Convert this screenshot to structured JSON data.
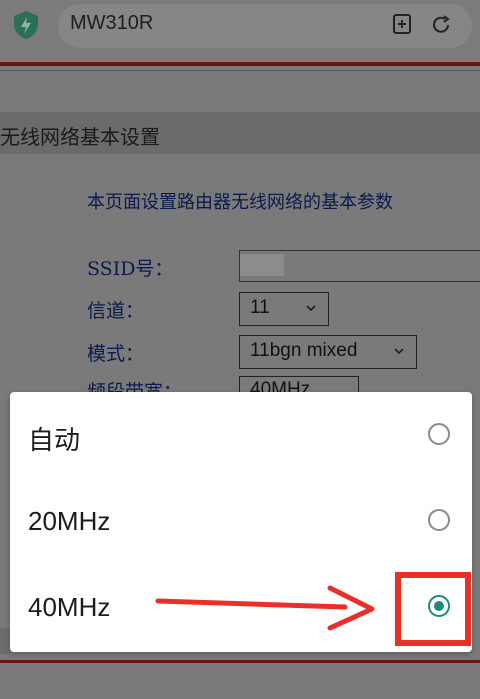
{
  "browser": {
    "url_title": "MW310R",
    "icons": [
      "shield-icon",
      "bookmark-add-icon",
      "reload-icon"
    ]
  },
  "page": {
    "section_title": "无线网络基本设置",
    "description": "本页面设置路由器无线网络的基本参数",
    "fields": {
      "ssid_label": "SSID号：",
      "channel_label": "信道：",
      "channel_value": "11",
      "mode_label": "模式：",
      "mode_value": "11bgn mixed",
      "bandwidth_label": "频段带宽：",
      "bandwidth_value": "40MHz"
    }
  },
  "dialog": {
    "options": [
      {
        "label": "自动",
        "checked": false
      },
      {
        "label": "20MHz",
        "checked": false
      },
      {
        "label": "40MHz",
        "checked": true
      }
    ]
  },
  "colors": {
    "radio_checked": "#1f8a7a",
    "annotation_red": "#e8302a"
  }
}
